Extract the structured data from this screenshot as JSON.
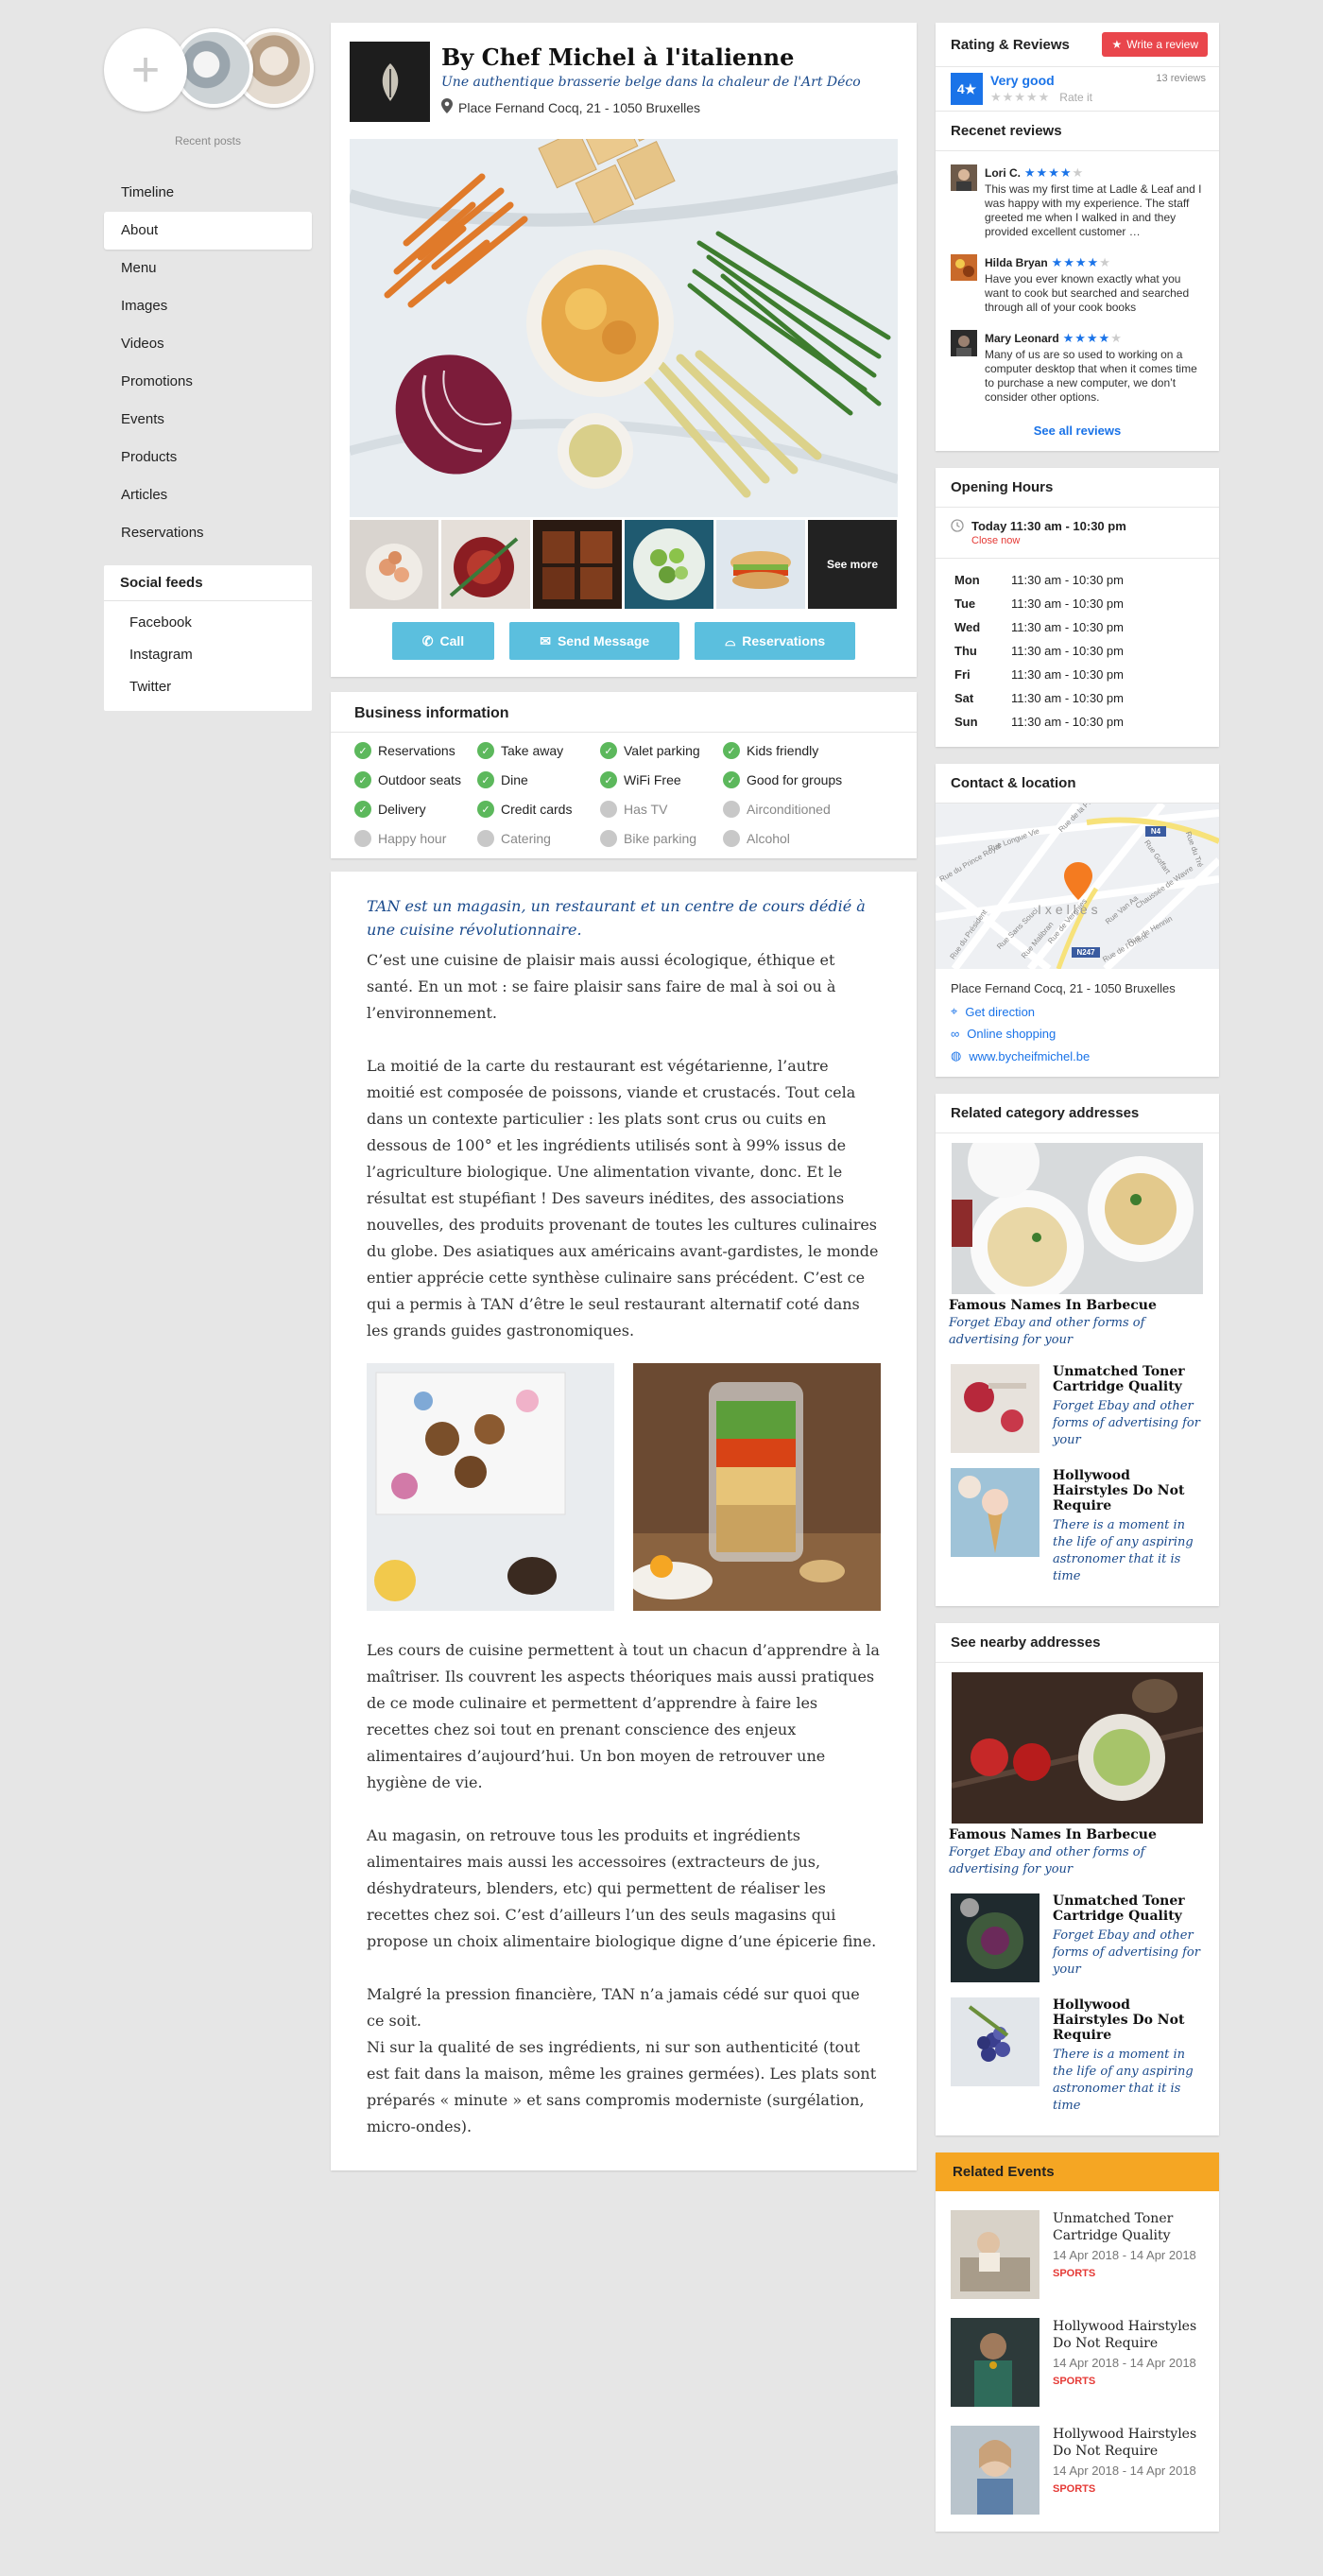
{
  "left": {
    "recent_posts_label": "Recent posts",
    "nav": [
      "Timeline",
      "About",
      "Menu",
      "Images",
      "Videos",
      "Promotions",
      "Events",
      "Products",
      "Articles",
      "Reservations"
    ],
    "social_title": "Social feeds",
    "social": [
      "Facebook",
      "Instagram",
      "Twitter"
    ]
  },
  "business": {
    "title": "By Chef Michel à l'italienne",
    "subtitle": "Une authentique brasserie belge dans la chaleur de l'Art Déco",
    "address": "Place Fernand Cocq, 21 - 1050 Bruxelles",
    "see_more": "See more",
    "buttons": {
      "call": "Call",
      "message": "Send Message",
      "reservations": "Reservations"
    }
  },
  "business_info": {
    "title": "Business information",
    "features": [
      {
        "label": "Reservations",
        "on": true
      },
      {
        "label": "Take away",
        "on": true
      },
      {
        "label": "Valet parking",
        "on": true
      },
      {
        "label": "Kids friendly",
        "on": true
      },
      {
        "label": "Outdoor seats",
        "on": true
      },
      {
        "label": "Dine",
        "on": true
      },
      {
        "label": "WiFi Free",
        "on": true
      },
      {
        "label": "Good for groups",
        "on": true
      },
      {
        "label": "Delivery",
        "on": true
      },
      {
        "label": "Credit cards",
        "on": true
      },
      {
        "label": "Has TV",
        "on": false
      },
      {
        "label": "Airconditioned",
        "on": false
      },
      {
        "label": "Happy hour",
        "on": false
      },
      {
        "label": "Catering",
        "on": false
      },
      {
        "label": "Bike parking",
        "on": false
      },
      {
        "label": "Alcohol",
        "on": false
      }
    ]
  },
  "article": {
    "lead": "TAN est un magasin, un restaurant et un centre de cours dédié à une cuisine révolutionnaire.",
    "p1": "C’est une cuisine de plaisir mais aussi écologique, éthique et santé. En un mot : se faire plaisir sans faire de mal à soi ou à l’environnement.",
    "p2": "La moitié de la carte du restaurant est végétarienne, l’autre moitié est composée de poissons, viande et crustacés. Tout cela dans un contexte particulier : les plats sont crus ou cuits en dessous de 100° et les ingrédients utilisés sont à 99% issus de l’agriculture biologique. Une alimentation vivante, donc. Et le résultat est stupéfiant ! Des saveurs inédites, des associations nouvelles, des produits provenant de toutes les cultures culinaires du globe. Des asiatiques aux américains avant-gardistes, le monde entier apprécie cette synthèse culinaire sans précédent. C’est ce qui a permis à TAN d’être le seul restaurant alternatif coté dans les grands guides gastronomiques.",
    "p3": "Les cours de cuisine permettent à tout un chacun d’apprendre à la maîtriser. Ils couvrent les aspects théoriques mais aussi pratiques de ce mode culinaire et permettent d’apprendre à faire les recettes chez soi tout en prenant conscience des enjeux alimentaires d’aujourd’hui. Un bon moyen de retrouver une hygiène de vie.",
    "p4": "Au magasin, on retrouve tous les produits et ingrédients alimentaires mais aussi les accessoires (extracteurs de jus, déshydrateurs, blenders, etc) qui permettent de réaliser les recettes chez soi. C’est d’ailleurs l’un des seuls magasins qui propose un choix alimentaire biologique digne d’une épicerie fine.",
    "p5a": "Malgré la pression financière, TAN n’a jamais cédé sur quoi que ce soit.",
    "p5b": "Ni sur la qualité de ses ingrédients, ni sur son authenticité (tout est fait dans la maison, même les graines germées). Les plats sont préparés « minute » et sans compromis moderniste (surgélation, micro-ondes)."
  },
  "reviews": {
    "title": "Rating & Reviews",
    "write": "Write a review",
    "score": "4",
    "score_label": "Very good",
    "count": "13 reviews",
    "rate_it": "Rate it",
    "recent_title": "Recenet reviews",
    "items": [
      {
        "name": "Lori C.",
        "stars": 4,
        "text": "This was my first time at Ladle & Leaf and I was happy with my experience. The staff greeted me when I walked in and they provided excellent customer …"
      },
      {
        "name": "Hilda Bryan",
        "stars": 4,
        "text": "Have you ever known exactly what you want to cook but searched and searched through all of your cook books"
      },
      {
        "name": "Mary Leonard",
        "stars": 4,
        "text": "Many of us are so used to working on a computer desktop that when it comes time to purchase a new computer, we don’t consider other options."
      }
    ],
    "see_all": "See all reviews"
  },
  "hours": {
    "title": "Opening Hours",
    "today": "Today 11:30 am - 10:30 pm",
    "status": "Close now",
    "days": [
      {
        "d": "Mon",
        "h": "11:30 am - 10:30 pm"
      },
      {
        "d": "Tue",
        "h": "11:30 am - 10:30 pm"
      },
      {
        "d": "Wed",
        "h": "11:30 am - 10:30 pm"
      },
      {
        "d": "Thu",
        "h": "11:30 am - 10:30 pm"
      },
      {
        "d": "Fri",
        "h": "11:30 am - 10:30 pm"
      },
      {
        "d": "Sat",
        "h": "11:30 am - 10:30 pm"
      },
      {
        "d": "Sun",
        "h": "11:30 am - 10:30 pm"
      }
    ]
  },
  "contact": {
    "title": "Contact & location",
    "map_label": "Ixelles",
    "map_streets": [
      "Rue du Prince Royal",
      "Rue de la Paix",
      "Rue Goffart",
      "Rue du Tré",
      "Rue de Hennin",
      "Chaussée de Wavre",
      "Rue Longue Vie",
      "Rue de Vergnies",
      "Rue du Président",
      "Rue Sans Souci",
      "Rue Malibran",
      "Rue Van Aa",
      "Rue de l'Orient"
    ],
    "map_road_labels": [
      "N4",
      "N247"
    ],
    "address": "Place Fernand Cocq, 21 - 1050 Bruxelles",
    "direction": "Get direction",
    "shopping": "Online shopping",
    "website": "www.bycheifmichel.be"
  },
  "related": {
    "title": "Related category addresses",
    "big": {
      "title": "Famous Names In Barbecue",
      "desc": "Forget Ebay and other forms of advertising for your"
    },
    "items": [
      {
        "title": "Unmatched Toner Cartridge Quality",
        "desc": "Forget Ebay and other forms of advertising for your"
      },
      {
        "title": "Hollywood Hairstyles Do Not Require",
        "desc": "There is a moment in the life of any aspiring astronomer that it is time"
      }
    ]
  },
  "nearby": {
    "title": "See nearby addresses",
    "big": {
      "title": "Famous Names In Barbecue",
      "desc": "Forget Ebay and other forms of advertising for your"
    },
    "items": [
      {
        "title": "Unmatched Toner Cartridge Quality",
        "desc": "Forget Ebay and other forms of advertising for your"
      },
      {
        "title": "Hollywood Hairstyles Do Not Require",
        "desc": "There is a moment in the life of any aspiring astronomer that it is time"
      }
    ]
  },
  "events": {
    "title": "Related Events",
    "items": [
      {
        "title": "Unmatched Toner Cartridge Quality",
        "date": "14 Apr 2018 - 14 Apr 2018",
        "tag": "SPORTS"
      },
      {
        "title": "Hollywood Hairstyles Do Not Require",
        "date": "14 Apr 2018 - 14 Apr 2018",
        "tag": "SPORTS"
      },
      {
        "title": "Hollywood Hairstyles Do Not Require",
        "date": "14 Apr 2018 - 14 Apr 2018",
        "tag": "SPORTS"
      }
    ]
  }
}
